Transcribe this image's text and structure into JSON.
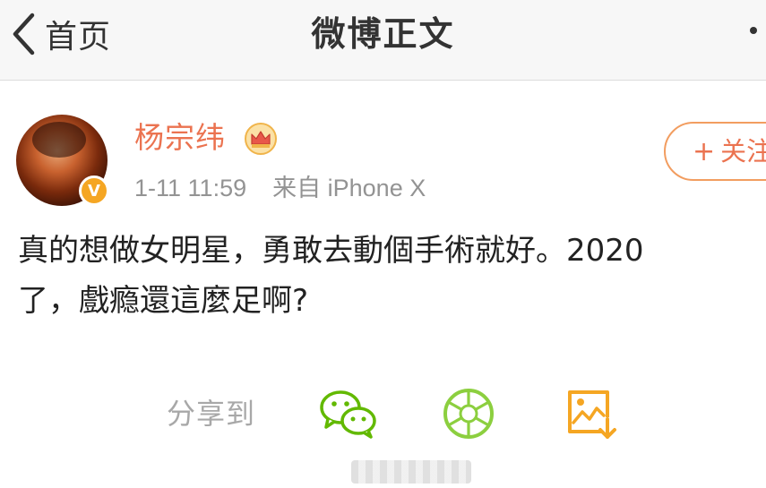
{
  "navbar": {
    "back_label": "首页",
    "title": "微博正文"
  },
  "post": {
    "author": "杨宗纬",
    "verified_badge": "V",
    "time": "1-11 11:59",
    "source": "来自 iPhone X",
    "follow": {
      "plus": "+",
      "label": "关注"
    },
    "text_lines": [
      "真的想做女明星，勇敢去動個手術就好。2020",
      "了，戲瘾還這麼足啊?"
    ]
  },
  "share": {
    "label": "分享到",
    "targets": [
      "wechat-icon",
      "moments-icon",
      "save-image-icon"
    ]
  },
  "colors": {
    "accent_orange": "#eb7350",
    "follow_border": "#f29d60",
    "wechat_green": "#62b900",
    "moments_green": "#8ccf3f",
    "save_orange": "#f5a623",
    "meta_gray": "#939393"
  }
}
